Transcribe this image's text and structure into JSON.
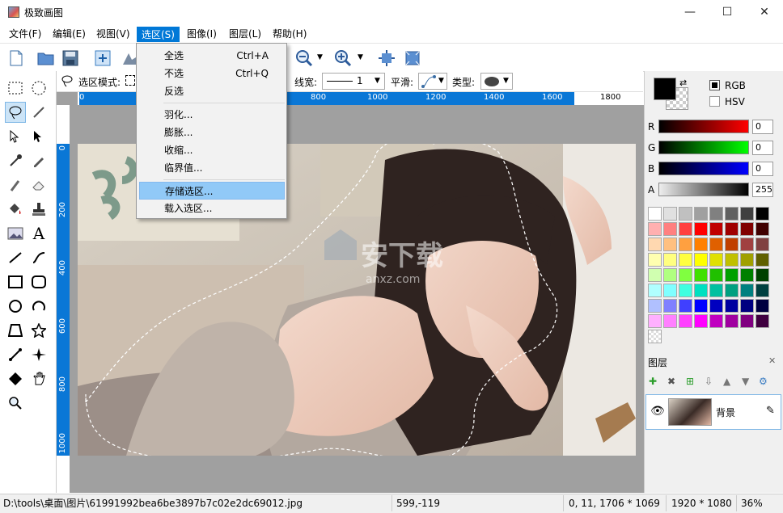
{
  "window": {
    "title": "极致画图",
    "minimize": "—",
    "maximize": "☐",
    "close": "✕"
  },
  "menubar": [
    "文件(F)",
    "编辑(E)",
    "视图(V)",
    "选区(S)",
    "图像(I)",
    "图层(L)",
    "帮助(H)"
  ],
  "selection_menu": {
    "items": [
      {
        "label": "全选",
        "shortcut": "Ctrl+A"
      },
      {
        "label": "不选",
        "shortcut": "Ctrl+Q"
      },
      {
        "label": "反选",
        "shortcut": ""
      },
      {
        "label": "羽化...",
        "shortcut": ""
      },
      {
        "label": "膨胀...",
        "shortcut": ""
      },
      {
        "label": "收缩...",
        "shortcut": ""
      },
      {
        "label": "临界值...",
        "shortcut": ""
      },
      {
        "label": "存储选区...",
        "shortcut": ""
      },
      {
        "label": "载入选区...",
        "shortcut": ""
      }
    ],
    "highlighted": "存储选区..."
  },
  "options_bar": {
    "mode_label": "选区模式:",
    "line_width_label": "线宽:",
    "line_width_value": "1",
    "smooth_label": "平滑:",
    "type_label": "类型:"
  },
  "ruler": {
    "h_ticks": [
      "0",
      "800",
      "1000",
      "1200",
      "1400",
      "1600",
      "1800"
    ],
    "v_ticks": [
      "0",
      "200",
      "400",
      "600",
      "800",
      "1000"
    ]
  },
  "color_panel": {
    "modes": [
      "RGB",
      "HSV"
    ],
    "selected_mode": "RGB",
    "channels": [
      {
        "name": "R",
        "value": "0",
        "color": "#ff0000"
      },
      {
        "name": "G",
        "value": "0",
        "color": "#00ff00"
      },
      {
        "name": "B",
        "value": "0",
        "color": "#0000ff"
      },
      {
        "name": "A",
        "value": "255",
        "color": "#000000"
      }
    ],
    "foreground": "#000000",
    "palette": [
      [
        "#ffffff",
        "#e0e0e0",
        "#c0c0c0",
        "#a0a0a0",
        "#808080",
        "#606060",
        "#404040",
        "#000000"
      ],
      [
        "#ffb0b0",
        "#ff8080",
        "#ff4040",
        "#ff0000",
        "#c00000",
        "#a00000",
        "#800000",
        "#400000"
      ],
      [
        "#ffd8b0",
        "#ffc080",
        "#ffa040",
        "#ff8000",
        "#e06000",
        "#c04000",
        "#a04040",
        "#804040"
      ],
      [
        "#ffffb0",
        "#ffff80",
        "#ffff40",
        "#ffff00",
        "#e0e000",
        "#c0c000",
        "#a0a000",
        "#606000"
      ],
      [
        "#d0ffb0",
        "#b0ff80",
        "#80ff40",
        "#40e000",
        "#20c000",
        "#00a000",
        "#008000",
        "#004000"
      ],
      [
        "#b0ffff",
        "#80ffff",
        "#40ffe0",
        "#00e0c0",
        "#00c0a0",
        "#00a080",
        "#008080",
        "#004040"
      ],
      [
        "#b0c0ff",
        "#8080ff",
        "#4040ff",
        "#0000ff",
        "#0000c0",
        "#0000a0",
        "#000080",
        "#000040"
      ],
      [
        "#ffb0ff",
        "#ff80ff",
        "#ff40ff",
        "#ff00ff",
        "#c000c0",
        "#a000a0",
        "#800080",
        "#400040"
      ]
    ]
  },
  "layers_panel": {
    "title": "图层",
    "close": "✕",
    "layers": [
      {
        "name": "背景"
      }
    ]
  },
  "statusbar": {
    "path": "D:\\tools\\桌面\\图片\\61991992bea6be3897b7c02e2dc69012.jpg",
    "cursor": "599,-119",
    "selection": "0, 11, 1706 * 1069",
    "size": "1920 * 1080",
    "zoom": "36%"
  },
  "watermark": {
    "text": "安下载",
    "sub": "anxz.com"
  }
}
